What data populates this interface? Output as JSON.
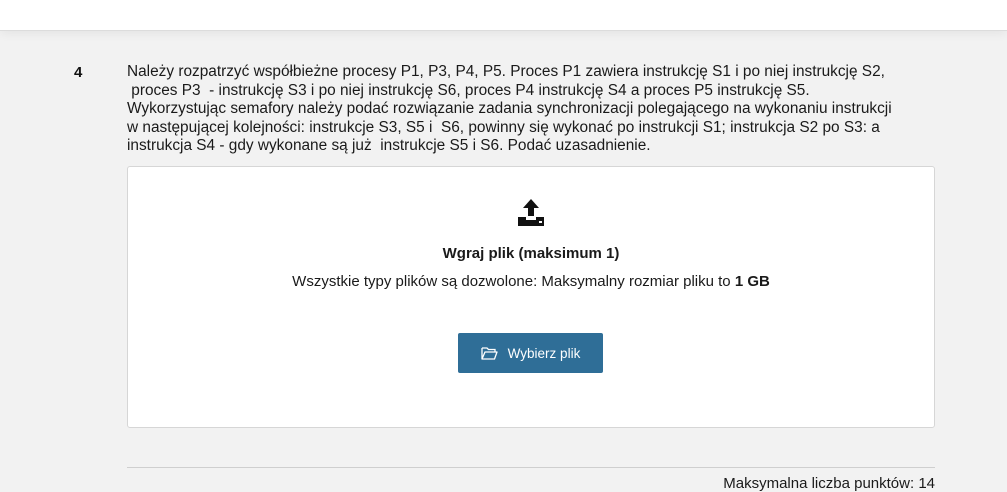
{
  "question": {
    "number": "4",
    "text": "Należy rozpatrzyć współbieżne procesy P1, P3, P4, P5. Proces P1 zawiera instrukcję S1 i po niej instrukcję S2,\n proces P3  - instrukcję S3 i po niej instrukcję S6, proces P4 instrukcję S4 a proces P5 instrukcję S5.\nWykorzystując semafory należy podać rozwiązanie zadania synchronizacji polegającego na wykonaniu instrukcji\nw następującej kolejności: instrukcje S3, S5 i  S6, powinny się wykonać po instrukcji S1; instrukcja S2 po S3: a\ninstrukcja S4 - gdy wykonane są już  instrukcje S5 i S6. Podać uzasadnienie."
  },
  "upload": {
    "icon": "upload-icon",
    "title": "Wgraj plik (maksimum 1)",
    "desc_prefix": "Wszystkie typy plików są dozwolone: Maksymalny rozmiar pliku to ",
    "desc_size": "1 GB",
    "button_icon": "folder-open-icon",
    "button_label": "Wybierz plik"
  },
  "footer": {
    "max_points": "Maksymalna liczba punktów: 14"
  },
  "colors": {
    "background": "#f2f2f2",
    "button": "#2f6e97",
    "card": "#ffffff"
  }
}
